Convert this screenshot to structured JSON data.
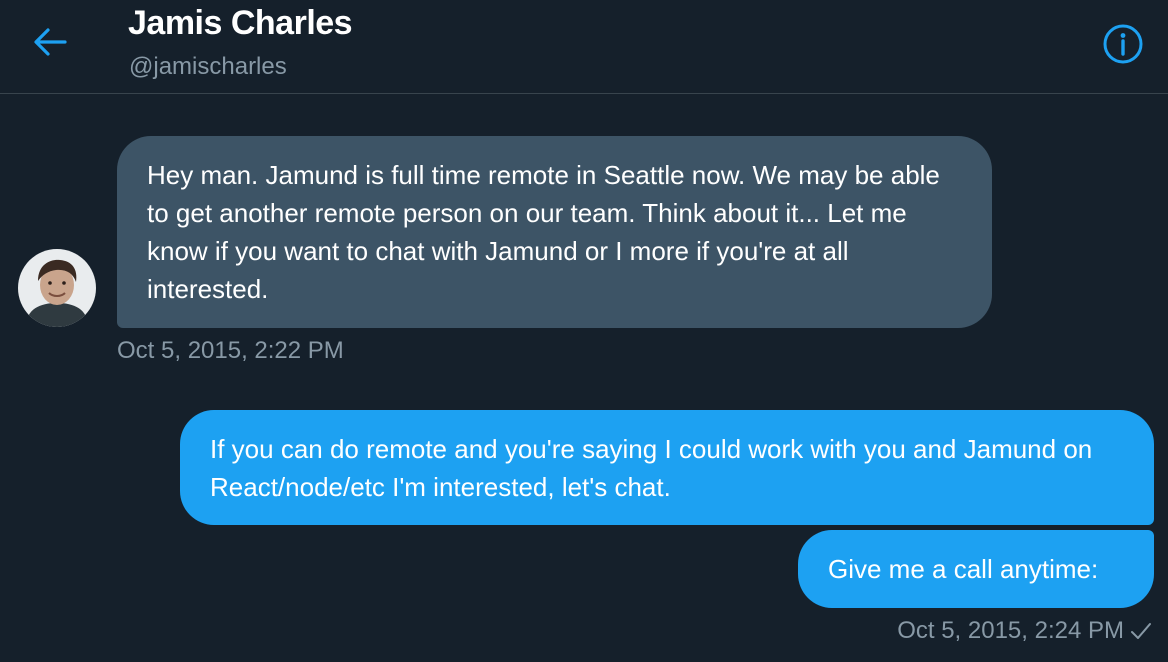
{
  "header": {
    "name": "Jamis Charles",
    "handle": "@jamischarles"
  },
  "icons": {
    "back": "arrow-left-icon",
    "info": "info-icon",
    "read_receipt": "checkmark-icon"
  },
  "colors": {
    "accent": "#1da1f2",
    "background": "#15202b",
    "incoming_bubble": "#3d5466",
    "secondary_text": "#8899a6"
  },
  "messages": [
    {
      "direction": "incoming",
      "text": "Hey man. Jamund is full time remote in Seattle now. We may be able to get another remote person on our team. Think about it... Let me know if you want to chat with Jamund or I more if you're at all interested.",
      "timestamp": "Oct 5, 2015, 2:22 PM"
    },
    {
      "direction": "outgoing",
      "text": "If you can do remote and you're saying I could work with you and Jamund on React/node/etc I'm interested, let's chat."
    },
    {
      "direction": "outgoing",
      "text": "Give me a call anytime:",
      "timestamp": "Oct 5, 2015, 2:24 PM"
    }
  ]
}
